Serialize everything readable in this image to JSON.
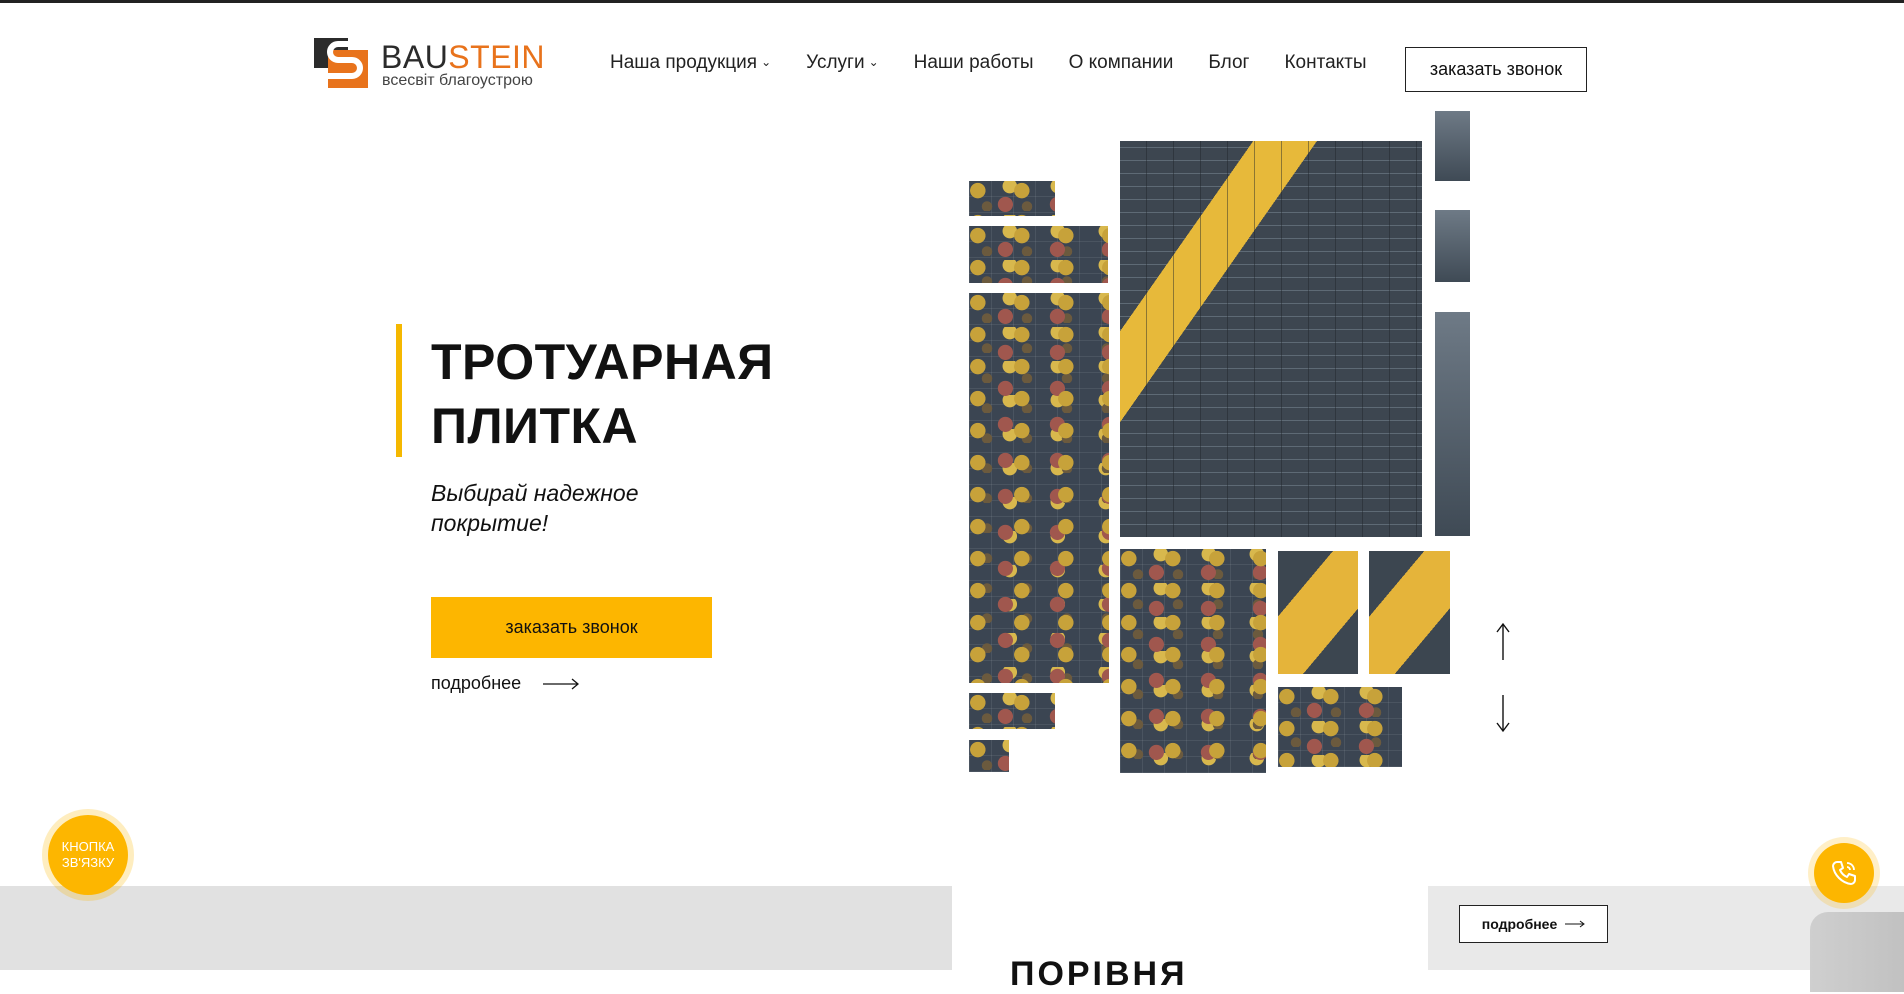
{
  "header": {
    "logo": {
      "word_part1": "BAU",
      "word_part2": "STEIN",
      "tagline": "всесвіт благоустрою"
    },
    "nav": [
      {
        "label": "Наша продукция",
        "has_dropdown": true
      },
      {
        "label": "Услуги",
        "has_dropdown": true
      },
      {
        "label": "Наши работы",
        "has_dropdown": false
      },
      {
        "label": "О компании",
        "has_dropdown": false
      },
      {
        "label": "Блог",
        "has_dropdown": false
      },
      {
        "label": "Контакты",
        "has_dropdown": false
      }
    ],
    "call_button": "заказать звонок"
  },
  "hero": {
    "title_line1": "ТРОТУАРНАЯ",
    "title_line2": "ПЛИТКА",
    "subtitle": "Выбирай надежное покрытие!",
    "cta": "заказать звонок",
    "more": "подробнее"
  },
  "slider": {
    "prev_icon": "arrow-up-icon",
    "next_icon": "arrow-down-icon"
  },
  "floating": {
    "contact_button": "КНОПКА ЗВ'ЯЗКУ",
    "phone_icon": "phone-icon"
  },
  "next_section": {
    "title": "ПОРІВНЯ",
    "more_button": "подробнее"
  },
  "colors": {
    "accent": "#fdb600",
    "brand_orange": "#e8731c",
    "dark": "#2b2b2b"
  }
}
